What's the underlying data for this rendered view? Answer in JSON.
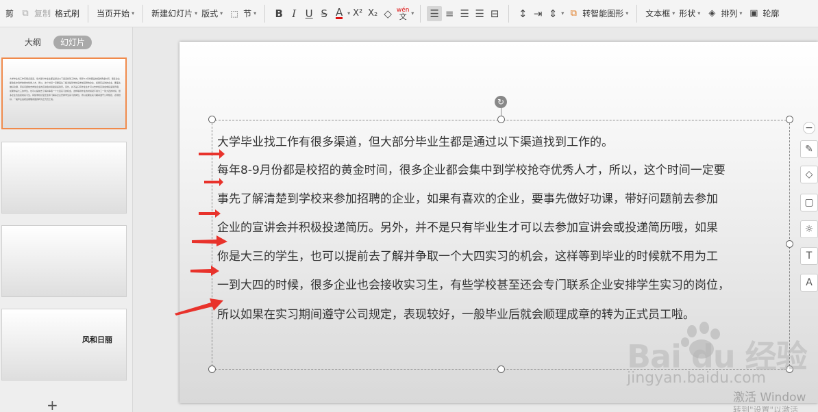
{
  "ribbon": {
    "cut_label": "剪",
    "copy_label": "复制",
    "format_painter_label": "格式刷",
    "start_from_current_label": "当页开始",
    "new_slide_label": "新建幻灯片",
    "layout_label": "版式",
    "section_label": "节",
    "smart_shape_label": "转智能图形",
    "textbox_label": "文本框",
    "shape_label": "形状",
    "arrange_label": "排列",
    "outline_label": "轮廓",
    "pinyin_label": "wén"
  },
  "left_panel": {
    "tabs": [
      "大纲",
      "幻灯片"
    ],
    "active_tab": "幻灯片",
    "thumb1_text": "大学毕业找工作有很多渠道，但大部分毕业生都是通过以下渠道找到工作的。每年8-9月份都是校招的黄金时间，很多企业都会集中到学校抢夺优秀人才，所以，这个时间一定要事先了解清楚到学校来参加招聘的企业，如果有喜欢的企业，要事先做好功课，带好问题前去参加企业的宣讲会并积极投递简历。另外，并不是只有毕业生才可以去参加宣讲会或投递简历哦，如果你是大三的学生，也可以提前去了解并争取一个大四实习的机会，这样等到毕业的时候就不用为工一到大四的时候，很多企业也会接收实习生，有些学校甚至还会专门联系企业安排学生实习的岗位，所以如果在实习期间遵守公司规定，表现较好，一般毕业后就会顺理成章的转为正式员工啦。",
    "thumb4_title": "风和日丽",
    "add_slide_symbol": "+"
  },
  "slide": {
    "lines": [
      "大学毕业找工作有很多渠道，但大部分毕业生都是通过以下渠道找到工作的。",
      "每年8-9月份都是校招的黄金时间，很多企业都会集中到学校抢夺优秀人才，所以，这个时间一定要",
      "事先了解清楚到学校来参加招聘的企业，如果有喜欢的企业，要事先做好功课，带好问题前去参加",
      "企业的宣讲会并积极投递简历。另外，并不是只有毕业生才可以去参加宣讲会或投递简历哦，如果",
      "你是大三的学生，也可以提前去了解并争取一个大四实习的机会，这样等到毕业的时候就不用为工",
      "一到大四的时候，很多企业也会接收实习生，有些学校甚至还会专门联系企业安排学生实习的岗位，",
      "所以如果在实习期间遵守公司规定，表现较好，一般毕业后就会顺理成章的转为正式员工啦。"
    ]
  },
  "watermark": {
    "brand": "Bai du 经验",
    "site": "jingyan.baidu.com",
    "activate": "激活 Window",
    "activate_sub": "转到\"设置\"以激活"
  },
  "colors": {
    "selection_border": "#f08a4b",
    "arrow_red": "#e8322b"
  }
}
